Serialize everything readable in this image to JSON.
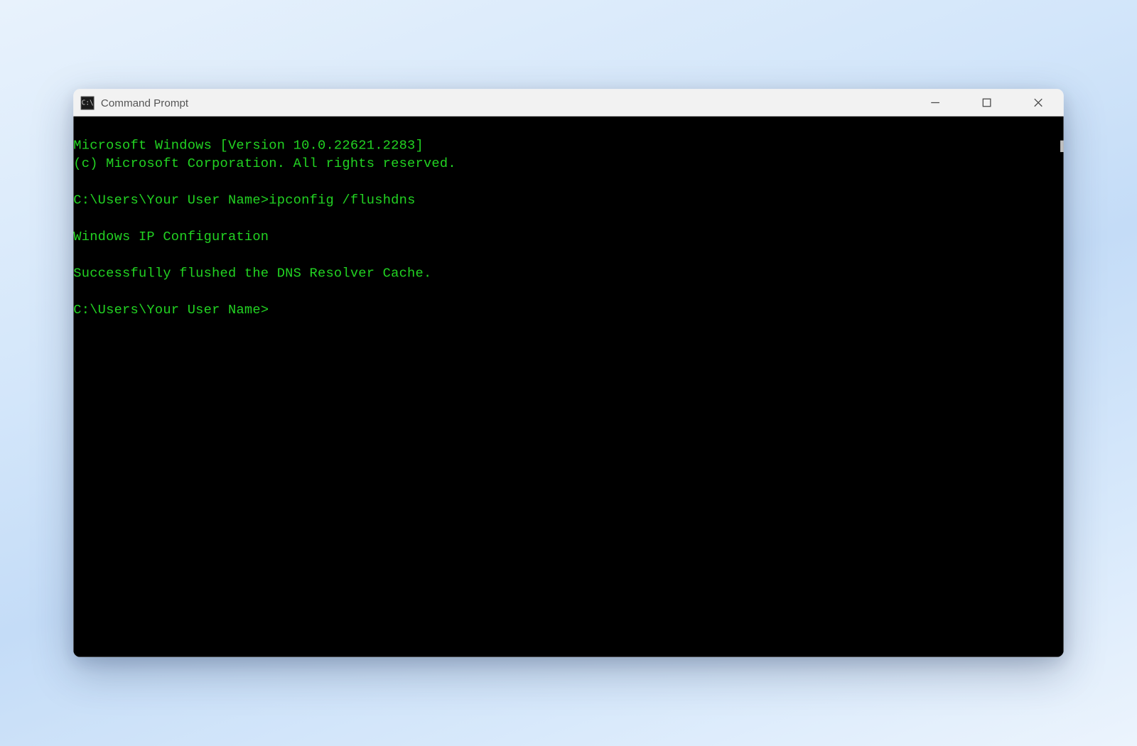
{
  "window": {
    "title": "Command Prompt"
  },
  "console": {
    "line1": "Microsoft Windows [Version 10.0.22621.2283]",
    "line2": "(c) Microsoft Corporation. All rights reserved.",
    "blank1": "",
    "prompt1_prefix": "C:\\Users\\",
    "prompt1_user": "Your User Name>",
    "command1": "ipconfig /flushdns",
    "blank2": "",
    "heading": "Windows IP Configuration",
    "blank3": "",
    "result": "Successfully flushed the DNS Resolver Cache.",
    "blank4": "",
    "prompt2_prefix": "C:\\Users\\",
    "prompt2_user": "Your User Name>"
  }
}
